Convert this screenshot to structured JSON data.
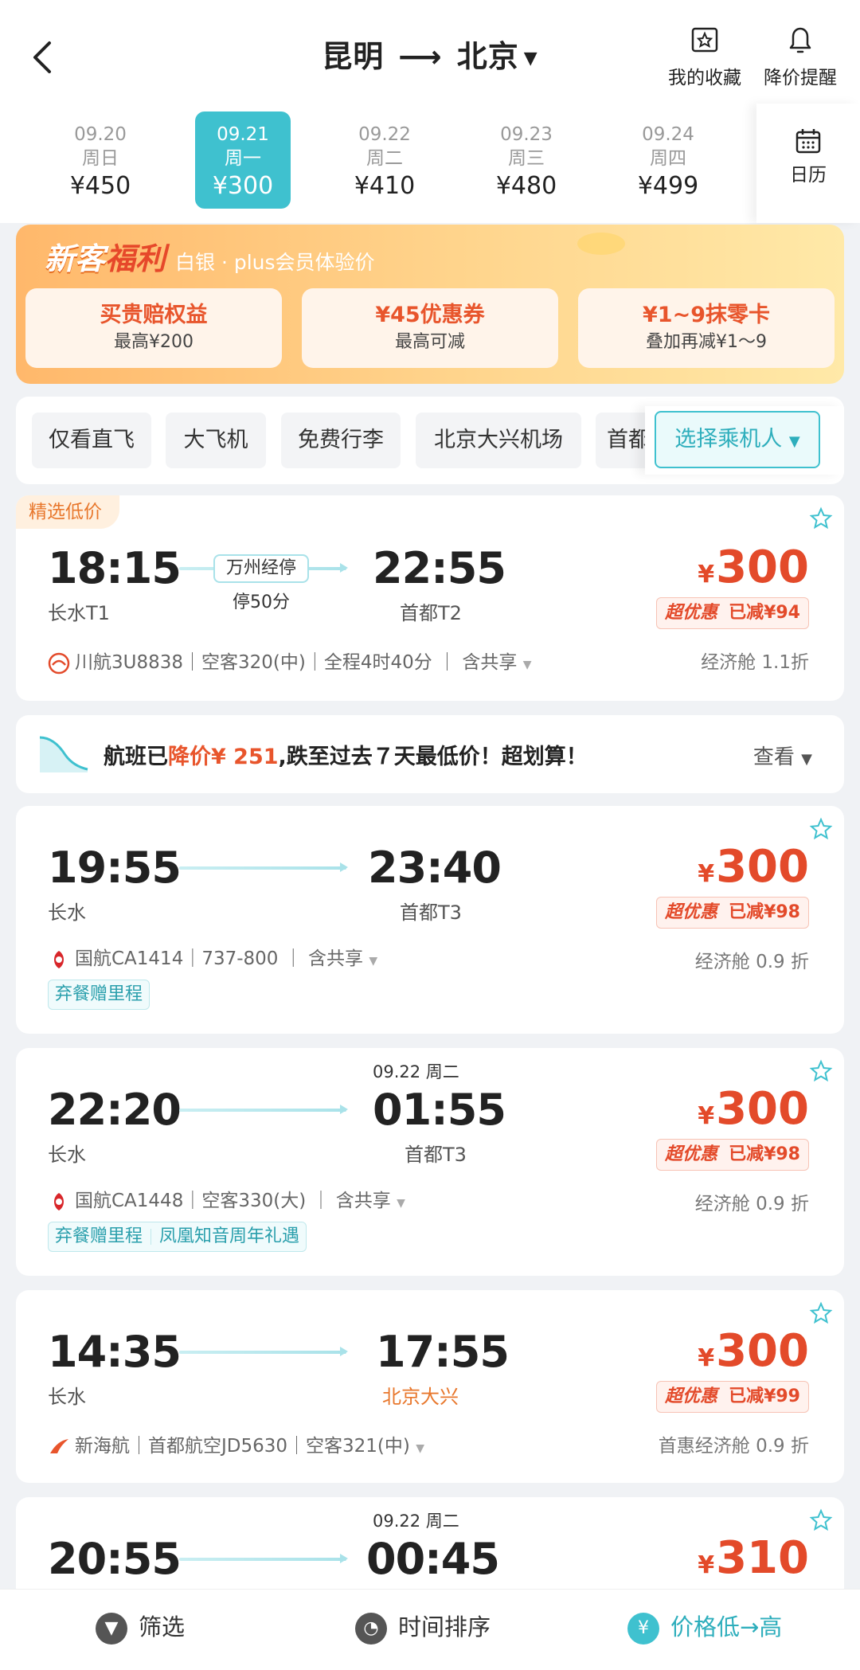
{
  "header": {
    "origin": "昆明",
    "destination": "北京",
    "favorites_label": "我的收藏",
    "price_alert_label": "降价提醒"
  },
  "dates": [
    {
      "date": "09.20",
      "weekday": "周日",
      "price": "¥450",
      "active": false
    },
    {
      "date": "09.21",
      "weekday": "周一",
      "price": "¥300",
      "active": true
    },
    {
      "date": "09.22",
      "weekday": "周二",
      "price": "¥410",
      "active": false
    },
    {
      "date": "09.23",
      "weekday": "周三",
      "price": "¥480",
      "active": false
    },
    {
      "date": "09.24",
      "weekday": "周四",
      "price": "¥499",
      "active": false
    }
  ],
  "calendar_label": "日历",
  "promo": {
    "title_a": "新客",
    "title_b": "福利",
    "subtitle": "白银 · plus会员体验价",
    "coupons": [
      {
        "title": "买贵赔权益",
        "sub": "最高¥200"
      },
      {
        "title": "¥45优惠券",
        "sub": "最高可减"
      },
      {
        "title": "¥1~9抹零卡",
        "sub": "叠加再减¥1～9"
      }
    ]
  },
  "filters": [
    "仅看直飞",
    "大飞机",
    "免费行李",
    "北京大兴机场",
    "首都"
  ],
  "passenger_button": "选择乘机人",
  "notice": {
    "prefix": "航班已",
    "highlight": "降价¥ 251",
    "suffix": ",跌至过去７天最低价！超划算！",
    "view": "查看"
  },
  "flights": [
    {
      "tag": "精选低价",
      "dep_time": "18:15",
      "dep_airport": "长水T1",
      "arr_time": "22:55",
      "arr_airport": "首都T2",
      "stop": "万州经停",
      "stop_duration": "停50分",
      "price": "300",
      "badge_a": "超优惠",
      "badge_b": "已减¥94",
      "airline": "川航3U8838｜空客320(中)｜全程4时40分 ｜ 含共享",
      "cabin": "经济舱 1.1折"
    },
    {
      "dep_time": "19:55",
      "dep_airport": "长水",
      "arr_time": "23:40",
      "arr_airport": "首都T3",
      "price": "300",
      "badge_a": "超优惠",
      "badge_b": "已减¥98",
      "airline": "国航CA1414｜737-800 ｜ 含共享",
      "cabin": "经济舱 0.9 折",
      "perks": [
        "弃餐赠里程"
      ]
    },
    {
      "next_day": "09.22 周二",
      "dep_time": "22:20",
      "dep_airport": "长水",
      "arr_time": "01:55",
      "arr_airport": "首都T3",
      "price": "300",
      "badge_a": "超优惠",
      "badge_b": "已减¥98",
      "airline": "国航CA1448｜空客330(大) ｜ 含共享",
      "cabin": "经济舱 0.9 折",
      "perks": [
        "弃餐赠里程",
        "凤凰知音周年礼遇"
      ]
    },
    {
      "dep_time": "14:35",
      "dep_airport": "长水",
      "arr_time": "17:55",
      "arr_airport": "北京大兴",
      "price": "300",
      "badge_a": "超优惠",
      "badge_b": "已减¥99",
      "airline": "新海航｜首都航空JD5630｜空客321(中)",
      "cabin": "首惠经济舱 0.9 折"
    },
    {
      "next_day": "09.22 周二",
      "dep_time": "20:55",
      "arr_time": "00:45",
      "price": "310"
    }
  ],
  "bottom": {
    "filter": "筛选",
    "time_sort": "时间排序",
    "price_sort": "价格低→高"
  }
}
